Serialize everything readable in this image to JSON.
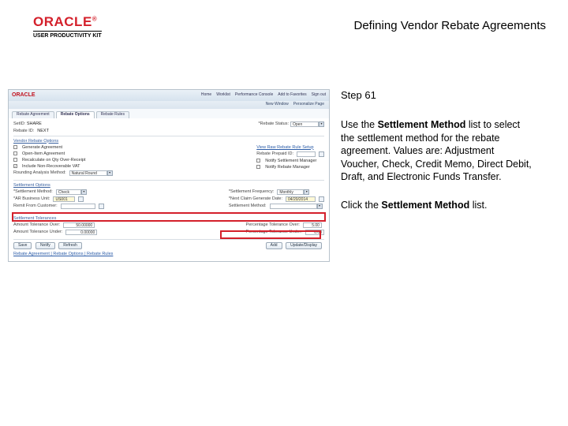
{
  "header": {
    "logo": "ORACLE",
    "reg": "®",
    "upk": "USER PRODUCTIVITY KIT",
    "title": "Defining Vendor Rebate Agreements"
  },
  "step": {
    "label": "Step 61"
  },
  "desc": {
    "t1": "Use the ",
    "b1": "Settlement Method",
    "t2": " list to select the settlement method for the rebate agreement. Values are: Adjustment Voucher, Check, Credit Memo, Direct Debit, Draft, and Electronic Funds Transfer."
  },
  "click": {
    "t1": "Click the ",
    "b1": "Settlement Method",
    "t2": " list."
  },
  "shot": {
    "logo": "ORACLE",
    "topnav": {
      "a": "Home",
      "b": "Worklist",
      "c": "Performance Console",
      "d": "Add to Favorites",
      "e": "Sign out"
    },
    "sub": {
      "a": "New Window",
      "b": "Personalize Page"
    },
    "tabs": {
      "a": "Rebate Agreement",
      "b": "Rebate Options",
      "c": "Rebate Rules"
    },
    "r1": {
      "lbl1": "SetID:",
      "val1": "SHARE",
      "lbl2": "*Rebate Status:",
      "val2": "Open"
    },
    "r2": {
      "lbl1": "Rebate ID:",
      "val1": "NEXT"
    },
    "sec1": "Vendor Rebate Options",
    "opt": {
      "a": "Generate Agreement",
      "b": "Open-Item Agreement",
      "c": "Recalculate on Qty Over-Receipt",
      "d": "Include Non-Recoverable VAT",
      "e": "Rounding Analysis Method:",
      "eval": "Natural Round",
      "f": "View Raw Rebate Rule Setup",
      "g": "Rebate Prepaid ID:",
      "h": "Notify Settlement Manager",
      "i": "Notify Rebate Manager"
    },
    "sec2": "Settlement Options",
    "settle": {
      "lbl1": "*Settlement Method:",
      "val1": "Check",
      "lbl2": "*Settlement Frequency:",
      "val2": "Monthly",
      "lbl3": "*AR Business Unit:",
      "val3": "US001",
      "lbl4": "*Next Claim Generate Date:",
      "val4": "04/20/2014",
      "lbl5": "Remit From Customer:",
      "lbl6": "Settlement Method:"
    },
    "sec3": "Settlement Tolerances",
    "tol": {
      "lbl1": "Amount Tolerance Over:",
      "val1": "50.00000",
      "lbl2": "Percentage Tolerance Over:",
      "val2": "5.00",
      "lbl3": "Amount Tolerance Under:",
      "val3": "0.00000",
      "lbl4": "Percentage Tolerance Under:",
      "val4": "0.00"
    },
    "btns": {
      "a": "Save",
      "b": "Notify",
      "c": "Refresh",
      "d": "Add",
      "e": "Update/Display"
    },
    "footer_link": "Rebate Agreement | Rebate Options | Rebate Rules"
  }
}
